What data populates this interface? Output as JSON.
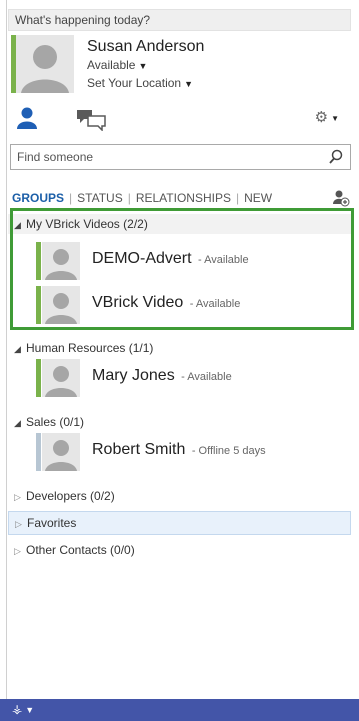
{
  "note": {
    "placeholder": "What's happening today?"
  },
  "me": {
    "name": "Susan Anderson",
    "status": "Available",
    "location": "Set Your Location",
    "presence_color": "#7ab24b"
  },
  "toolbar": {
    "contacts_icon": "contacts-icon",
    "conversations_icon": "conversations-icon",
    "options_icon": "gear-icon"
  },
  "search": {
    "placeholder": "Find someone"
  },
  "tabs": [
    "GROUPS",
    "STATUS",
    "RELATIONSHIPS",
    "NEW"
  ],
  "groups": [
    {
      "name": "My VBrick Videos (2/2)",
      "expanded": true,
      "contacts": [
        {
          "name": "DEMO-Advert",
          "status": "- Available",
          "presence_color": "#7ab24b"
        },
        {
          "name": "VBrick Video",
          "status": "- Available",
          "presence_color": "#7ab24b"
        }
      ]
    },
    {
      "name": "Human Resources (1/1)",
      "expanded": true,
      "contacts": [
        {
          "name": "Mary Jones",
          "status": "- Available",
          "presence_color": "#7ab24b"
        }
      ]
    },
    {
      "name": "Sales (0/1)",
      "expanded": true,
      "contacts": [
        {
          "name": "Robert Smith",
          "status": "- Offline 5 days",
          "presence_color": "#b7c6d3"
        }
      ]
    },
    {
      "name": "Developers (0/2)",
      "expanded": false,
      "contacts": []
    },
    {
      "name": "Favorites",
      "expanded": false,
      "contacts": []
    },
    {
      "name": "Other Contacts (0/0)",
      "expanded": false,
      "contacts": []
    }
  ],
  "colors": {
    "accent": "#1c5fa8",
    "highlight_border": "#3f9b36",
    "footer": "#4355a8"
  }
}
